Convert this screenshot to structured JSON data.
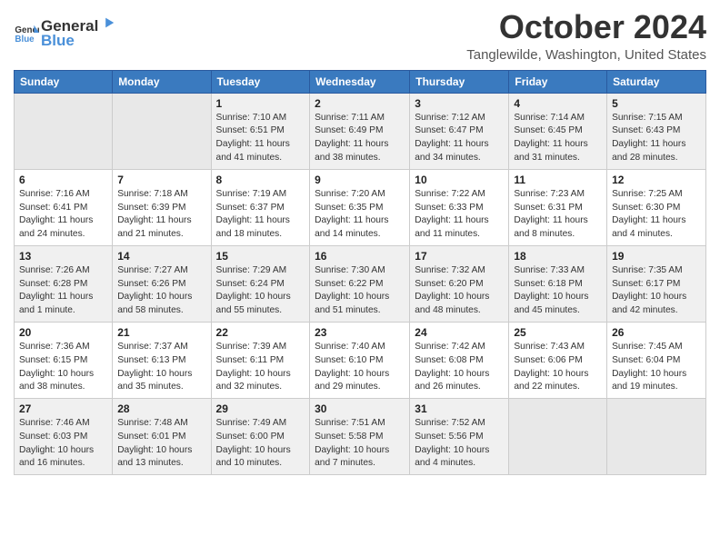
{
  "logo": {
    "line1": "General",
    "line2": "Blue"
  },
  "title": "October 2024",
  "location": "Tanglewilde, Washington, United States",
  "days_of_week": [
    "Sunday",
    "Monday",
    "Tuesday",
    "Wednesday",
    "Thursday",
    "Friday",
    "Saturday"
  ],
  "weeks": [
    [
      {
        "day": "",
        "empty": true
      },
      {
        "day": "",
        "empty": true
      },
      {
        "day": "1",
        "sunrise": "7:10 AM",
        "sunset": "6:51 PM",
        "daylight": "11 hours and 41 minutes."
      },
      {
        "day": "2",
        "sunrise": "7:11 AM",
        "sunset": "6:49 PM",
        "daylight": "11 hours and 38 minutes."
      },
      {
        "day": "3",
        "sunrise": "7:12 AM",
        "sunset": "6:47 PM",
        "daylight": "11 hours and 34 minutes."
      },
      {
        "day": "4",
        "sunrise": "7:14 AM",
        "sunset": "6:45 PM",
        "daylight": "11 hours and 31 minutes."
      },
      {
        "day": "5",
        "sunrise": "7:15 AM",
        "sunset": "6:43 PM",
        "daylight": "11 hours and 28 minutes."
      }
    ],
    [
      {
        "day": "6",
        "sunrise": "7:16 AM",
        "sunset": "6:41 PM",
        "daylight": "11 hours and 24 minutes."
      },
      {
        "day": "7",
        "sunrise": "7:18 AM",
        "sunset": "6:39 PM",
        "daylight": "11 hours and 21 minutes."
      },
      {
        "day": "8",
        "sunrise": "7:19 AM",
        "sunset": "6:37 PM",
        "daylight": "11 hours and 18 minutes."
      },
      {
        "day": "9",
        "sunrise": "7:20 AM",
        "sunset": "6:35 PM",
        "daylight": "11 hours and 14 minutes."
      },
      {
        "day": "10",
        "sunrise": "7:22 AM",
        "sunset": "6:33 PM",
        "daylight": "11 hours and 11 minutes."
      },
      {
        "day": "11",
        "sunrise": "7:23 AM",
        "sunset": "6:31 PM",
        "daylight": "11 hours and 8 minutes."
      },
      {
        "day": "12",
        "sunrise": "7:25 AM",
        "sunset": "6:30 PM",
        "daylight": "11 hours and 4 minutes."
      }
    ],
    [
      {
        "day": "13",
        "sunrise": "7:26 AM",
        "sunset": "6:28 PM",
        "daylight": "11 hours and 1 minute."
      },
      {
        "day": "14",
        "sunrise": "7:27 AM",
        "sunset": "6:26 PM",
        "daylight": "10 hours and 58 minutes."
      },
      {
        "day": "15",
        "sunrise": "7:29 AM",
        "sunset": "6:24 PM",
        "daylight": "10 hours and 55 minutes."
      },
      {
        "day": "16",
        "sunrise": "7:30 AM",
        "sunset": "6:22 PM",
        "daylight": "10 hours and 51 minutes."
      },
      {
        "day": "17",
        "sunrise": "7:32 AM",
        "sunset": "6:20 PM",
        "daylight": "10 hours and 48 minutes."
      },
      {
        "day": "18",
        "sunrise": "7:33 AM",
        "sunset": "6:18 PM",
        "daylight": "10 hours and 45 minutes."
      },
      {
        "day": "19",
        "sunrise": "7:35 AM",
        "sunset": "6:17 PM",
        "daylight": "10 hours and 42 minutes."
      }
    ],
    [
      {
        "day": "20",
        "sunrise": "7:36 AM",
        "sunset": "6:15 PM",
        "daylight": "10 hours and 38 minutes."
      },
      {
        "day": "21",
        "sunrise": "7:37 AM",
        "sunset": "6:13 PM",
        "daylight": "10 hours and 35 minutes."
      },
      {
        "day": "22",
        "sunrise": "7:39 AM",
        "sunset": "6:11 PM",
        "daylight": "10 hours and 32 minutes."
      },
      {
        "day": "23",
        "sunrise": "7:40 AM",
        "sunset": "6:10 PM",
        "daylight": "10 hours and 29 minutes."
      },
      {
        "day": "24",
        "sunrise": "7:42 AM",
        "sunset": "6:08 PM",
        "daylight": "10 hours and 26 minutes."
      },
      {
        "day": "25",
        "sunrise": "7:43 AM",
        "sunset": "6:06 PM",
        "daylight": "10 hours and 22 minutes."
      },
      {
        "day": "26",
        "sunrise": "7:45 AM",
        "sunset": "6:04 PM",
        "daylight": "10 hours and 19 minutes."
      }
    ],
    [
      {
        "day": "27",
        "sunrise": "7:46 AM",
        "sunset": "6:03 PM",
        "daylight": "10 hours and 16 minutes."
      },
      {
        "day": "28",
        "sunrise": "7:48 AM",
        "sunset": "6:01 PM",
        "daylight": "10 hours and 13 minutes."
      },
      {
        "day": "29",
        "sunrise": "7:49 AM",
        "sunset": "6:00 PM",
        "daylight": "10 hours and 10 minutes."
      },
      {
        "day": "30",
        "sunrise": "7:51 AM",
        "sunset": "5:58 PM",
        "daylight": "10 hours and 7 minutes."
      },
      {
        "day": "31",
        "sunrise": "7:52 AM",
        "sunset": "5:56 PM",
        "daylight": "10 hours and 4 minutes."
      },
      {
        "day": "",
        "empty": true
      },
      {
        "day": "",
        "empty": true
      }
    ]
  ],
  "labels": {
    "sunrise": "Sunrise:",
    "sunset": "Sunset:",
    "daylight": "Daylight:"
  }
}
